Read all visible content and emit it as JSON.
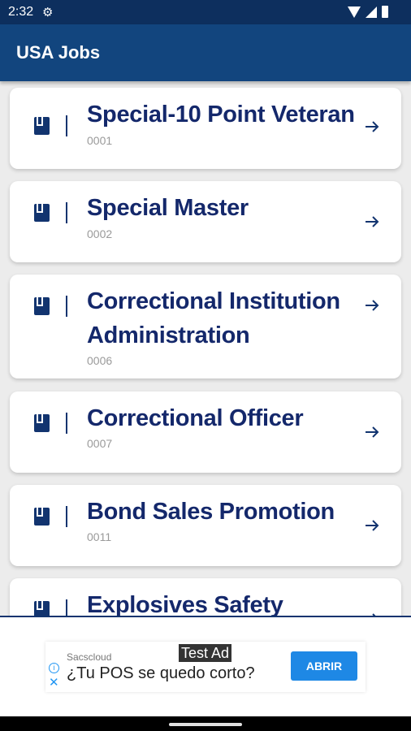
{
  "status_bar": {
    "time": "2:32",
    "settings_icon": "gear-icon",
    "icons": [
      "wifi-icon",
      "signal-icon",
      "battery-icon"
    ]
  },
  "app_bar": {
    "title": "USA Jobs"
  },
  "jobs": [
    {
      "title": "Special-10 Point Veteran",
      "code": "0001"
    },
    {
      "title": "Special Master",
      "code": "0002"
    },
    {
      "title": "Correctional Institution Administration",
      "code": "0006"
    },
    {
      "title": "Correctional Officer",
      "code": "0007"
    },
    {
      "title": "Bond Sales Promotion",
      "code": "0011"
    },
    {
      "title": "Explosives Safety Series",
      "code": ""
    }
  ],
  "ad": {
    "test_label": "Test Ad",
    "advertiser": "Sacscloud",
    "headline": "¿Tu POS se quedo corto?",
    "cta": "ABRIR"
  },
  "colors": {
    "status_bar": "#0d2f5e",
    "app_bar": "#12457e",
    "title_text": "#14286b",
    "cta": "#1e88e5"
  }
}
